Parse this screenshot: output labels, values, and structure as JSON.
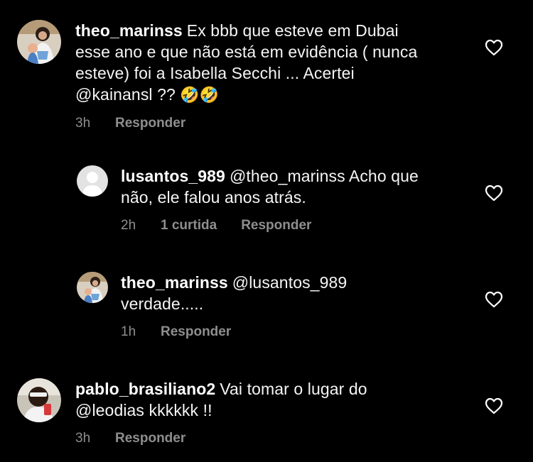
{
  "comments": [
    {
      "username": "theo_marinss",
      "text_lines": [
        "Ex bbb que esteve em Dubai",
        "esse ano e que não está em evidência ( nunca",
        "esteve) foi a Isabella Secchi ... Acertei",
        "@kainansl ??"
      ],
      "emoji": "🤣🤣",
      "time": "3h",
      "reply_label": "Responder"
    },
    {
      "username": "lusantos_989",
      "text_lines": [
        "@theo_marinss Acho que",
        "não, ele falou anos atrás."
      ],
      "time": "2h",
      "likes": "1 curtida",
      "reply_label": "Responder"
    },
    {
      "username": "theo_marinss",
      "text_lines": [
        "@lusantos_989",
        "verdade....."
      ],
      "time": "1h",
      "reply_label": "Responder"
    },
    {
      "username": "pablo_brasiliano2",
      "text_lines": [
        "Vai tomar o lugar do",
        "@leodias  kkkkkk !!"
      ],
      "time": "3h",
      "reply_label": "Responder"
    }
  ],
  "icons": {
    "like": "heart-outline-icon",
    "emoji": "rolling-on-floor-laughing-emoji"
  },
  "colors": {
    "background": "#000000",
    "text": "#f5f5f5",
    "meta": "#8e8e8e"
  }
}
